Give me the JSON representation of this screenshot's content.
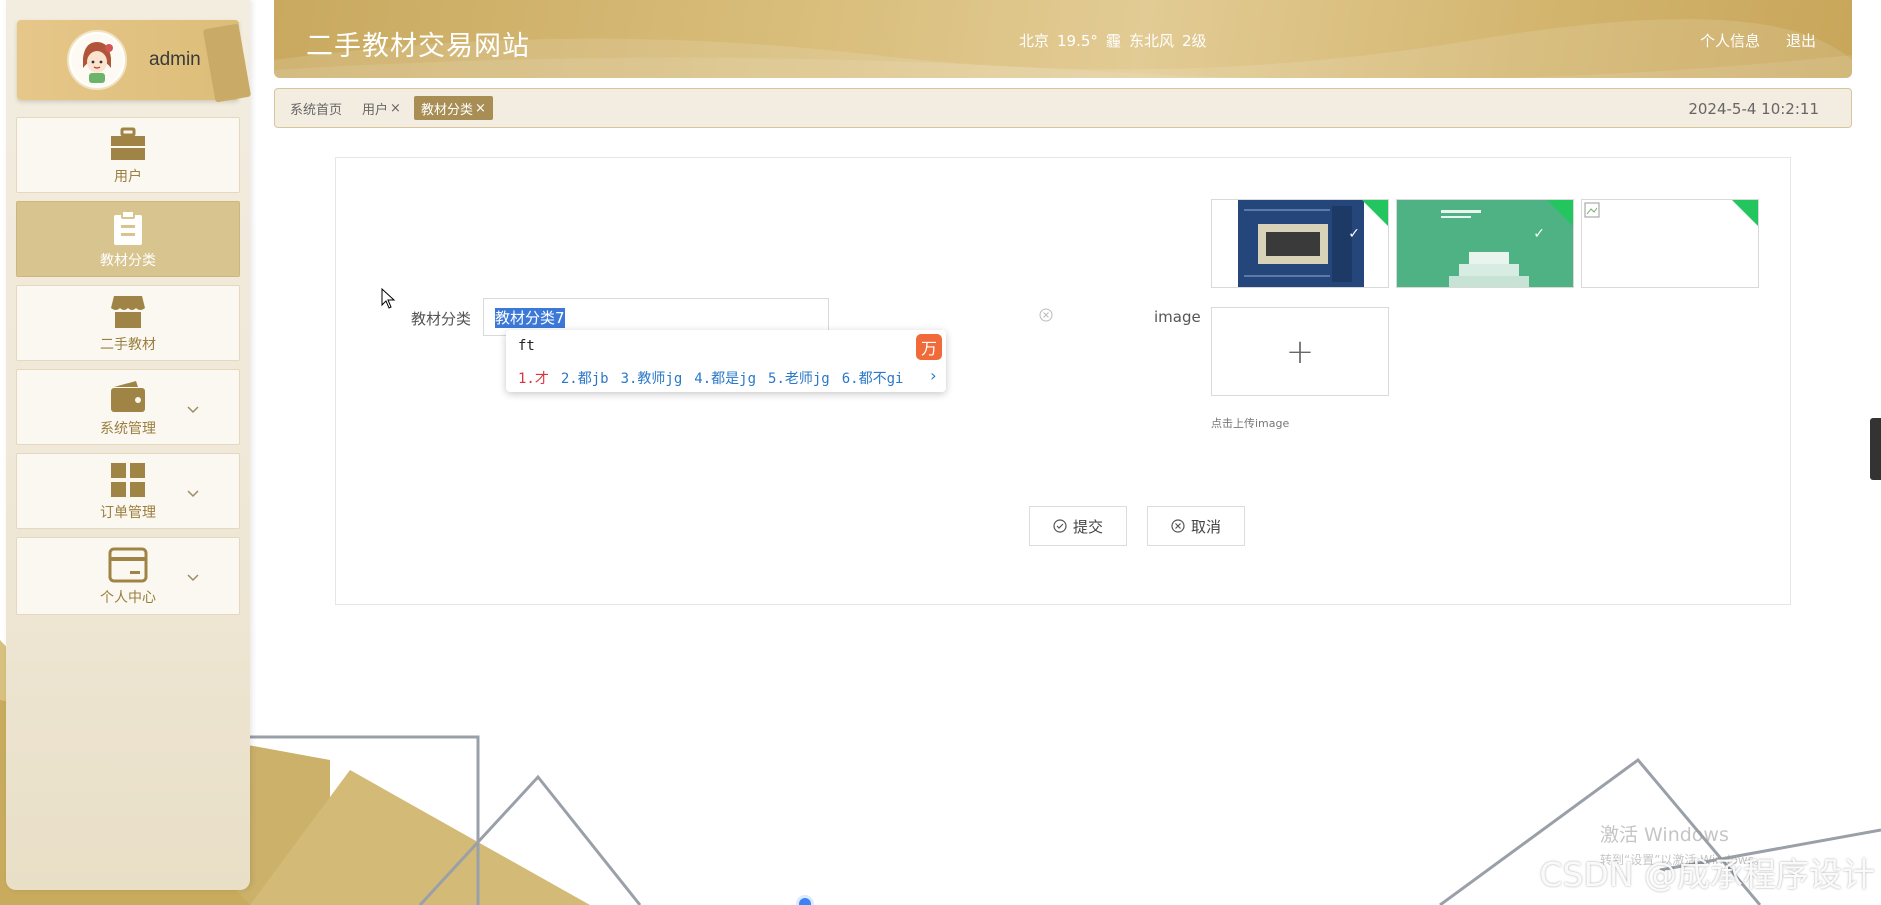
{
  "colors": {
    "accent": "#c9a95f",
    "active_menu": "#d7c48e",
    "tag_active": "#a88e55",
    "upload_corner": "#22c55e"
  },
  "user": {
    "name": "admin",
    "avatar_icon": "avatar-girl-icon"
  },
  "menu": [
    {
      "label": "用户",
      "icon": "briefcase-icon",
      "active": false,
      "expandable": false
    },
    {
      "label": "教材分类",
      "icon": "clipboard-icon",
      "active": true,
      "expandable": false
    },
    {
      "label": "二手教材",
      "icon": "shop-icon",
      "active": false,
      "expandable": false
    },
    {
      "label": "系统管理",
      "icon": "wallet-icon",
      "active": false,
      "expandable": true
    },
    {
      "label": "订单管理",
      "icon": "grid-icon",
      "active": false,
      "expandable": true
    },
    {
      "label": "个人中心",
      "icon": "card-icon",
      "active": false,
      "expandable": true
    }
  ],
  "header": {
    "title": "二手教材交易网站",
    "weather": {
      "city": "北京",
      "temp": "19.5°",
      "condition_icon": "haze-icon",
      "condition": "霾",
      "wind": "东北风",
      "level": "2级"
    },
    "links": {
      "profile": "个人信息",
      "logout": "退出"
    }
  },
  "tags": [
    {
      "label": "系统首页",
      "closable": false,
      "active": false
    },
    {
      "label": "用户",
      "closable": true,
      "active": false
    },
    {
      "label": "教材分类",
      "closable": true,
      "active": true
    }
  ],
  "close_symbol": "×",
  "timestamp": "2024-5-4 10:2:11",
  "form": {
    "category_label": "教材分类",
    "category_value": "教材分类7",
    "image_label": "image",
    "upload_tip": "点击上传image",
    "upload_plus": "+",
    "submit_label": "提交",
    "cancel_label": "取消"
  },
  "ime": {
    "pinyin": "ft",
    "candidates": [
      "1.才",
      "2.都jb",
      "3.教师jg",
      "4.都是jg",
      "5.老师jg",
      "6.都不gi"
    ],
    "logo": "万",
    "more_icon": "chevron-right-icon",
    "more_symbol": "›"
  },
  "watermark": {
    "line1": "激活 Windows",
    "line2": "转到“设置”以激活 Windows。"
  },
  "csdn": "CSDN @成承程序设计"
}
